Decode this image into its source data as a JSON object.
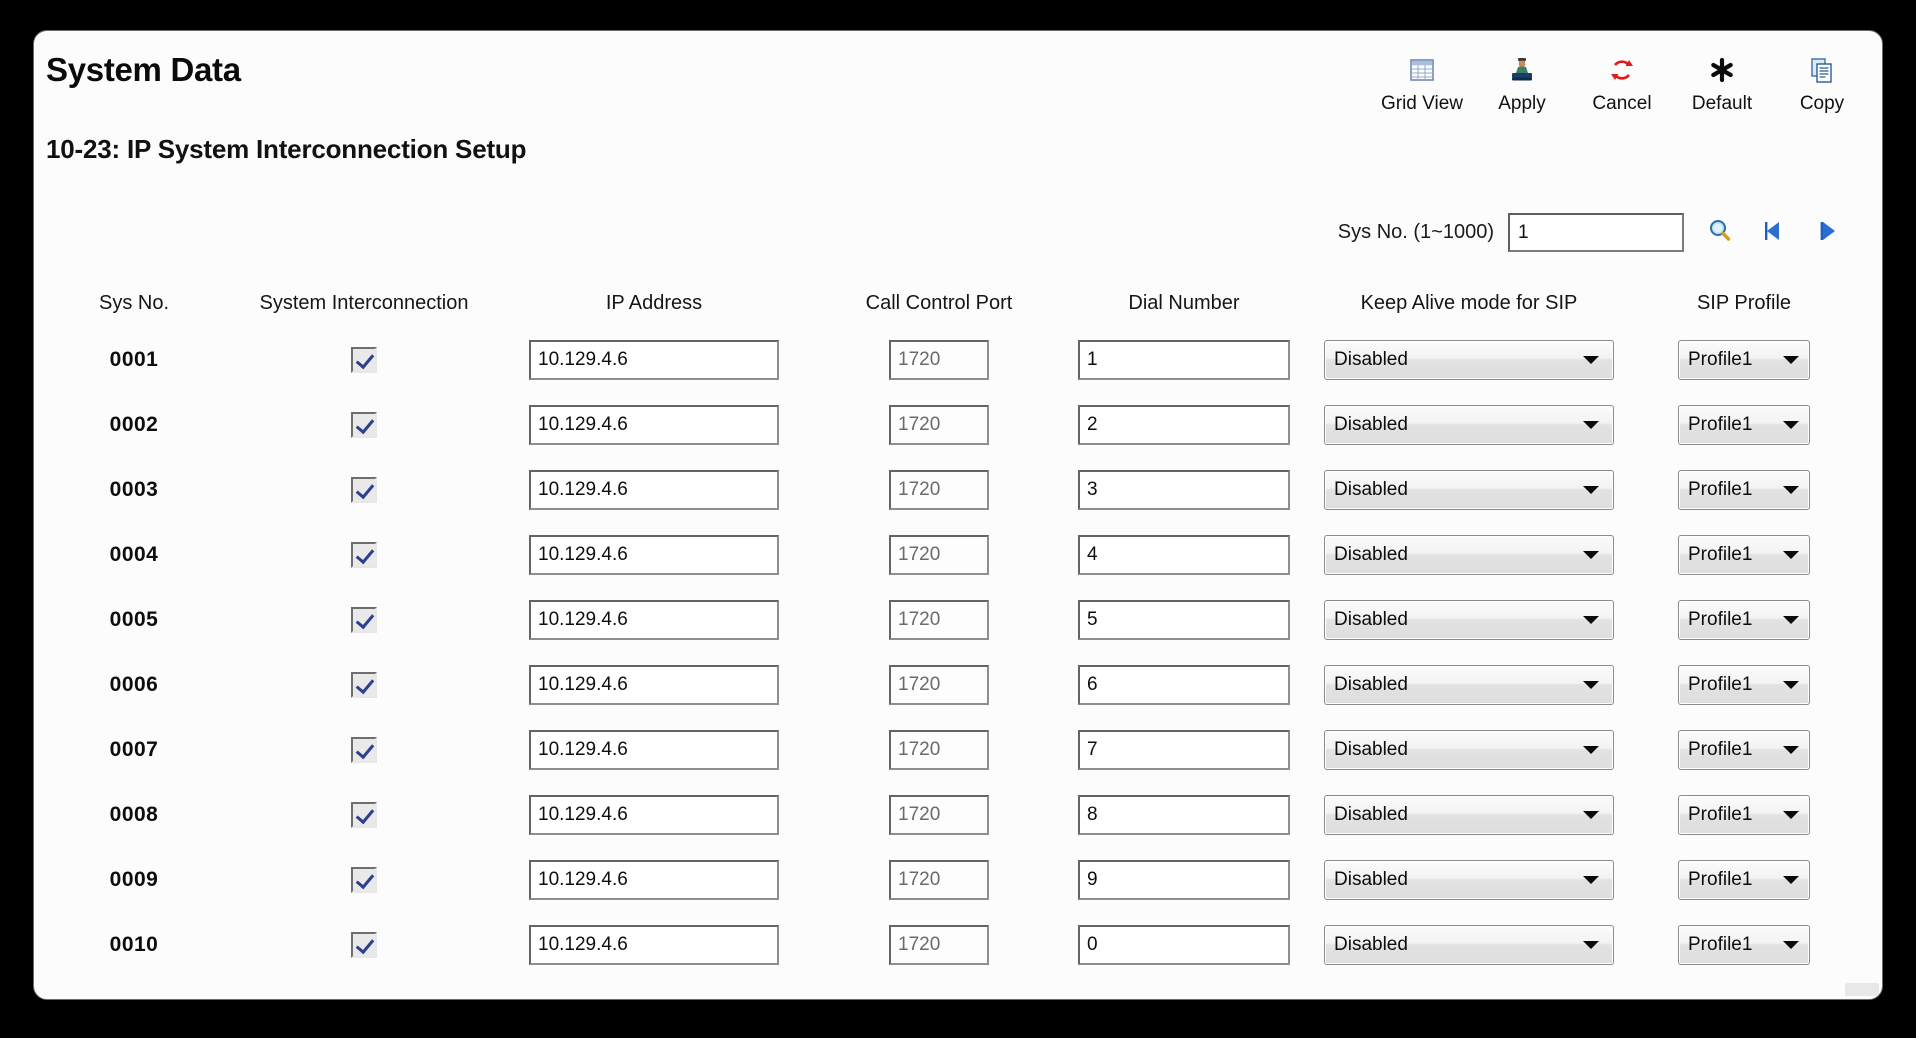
{
  "window": {
    "title": "System Data",
    "subtitle": "10-23: IP System Interconnection Setup"
  },
  "toolbar": {
    "buttons": [
      {
        "label": "Grid View",
        "icon": "grid-view-icon"
      },
      {
        "label": "Apply",
        "icon": "apply-stamp-icon"
      },
      {
        "label": "Cancel",
        "icon": "cancel-refresh-icon"
      },
      {
        "label": "Default",
        "icon": "default-asterisk-icon"
      },
      {
        "label": "Copy",
        "icon": "copy-pages-icon"
      }
    ]
  },
  "search": {
    "label": "Sys No. (1~1000)",
    "value": "1",
    "placeholder": "",
    "go_icon": "magnifier-icon",
    "prev_icon": "previous-arrow-icon",
    "next_icon": "next-arrow-icon"
  },
  "table": {
    "headers": [
      "Sys No.",
      "System Interconnection",
      "IP Address",
      "Call Control Port",
      "Dial Number",
      "Keep Alive mode for SIP",
      "SIP Profile"
    ],
    "rows": [
      {
        "sys_no": "0001",
        "interconnection": true,
        "ip_address": "10.129.4.6",
        "call_control_port": "1720",
        "dial_number": "1",
        "keep_alive": "Disabled",
        "sip_profile": "Profile1"
      },
      {
        "sys_no": "0002",
        "interconnection": true,
        "ip_address": "10.129.4.6",
        "call_control_port": "1720",
        "dial_number": "2",
        "keep_alive": "Disabled",
        "sip_profile": "Profile1"
      },
      {
        "sys_no": "0003",
        "interconnection": true,
        "ip_address": "10.129.4.6",
        "call_control_port": "1720",
        "dial_number": "3",
        "keep_alive": "Disabled",
        "sip_profile": "Profile1"
      },
      {
        "sys_no": "0004",
        "interconnection": true,
        "ip_address": "10.129.4.6",
        "call_control_port": "1720",
        "dial_number": "4",
        "keep_alive": "Disabled",
        "sip_profile": "Profile1"
      },
      {
        "sys_no": "0005",
        "interconnection": true,
        "ip_address": "10.129.4.6",
        "call_control_port": "1720",
        "dial_number": "5",
        "keep_alive": "Disabled",
        "sip_profile": "Profile1"
      },
      {
        "sys_no": "0006",
        "interconnection": true,
        "ip_address": "10.129.4.6",
        "call_control_port": "1720",
        "dial_number": "6",
        "keep_alive": "Disabled",
        "sip_profile": "Profile1"
      },
      {
        "sys_no": "0007",
        "interconnection": true,
        "ip_address": "10.129.4.6",
        "call_control_port": "1720",
        "dial_number": "7",
        "keep_alive": "Disabled",
        "sip_profile": "Profile1"
      },
      {
        "sys_no": "0008",
        "interconnection": true,
        "ip_address": "10.129.4.6",
        "call_control_port": "1720",
        "dial_number": "8",
        "keep_alive": "Disabled",
        "sip_profile": "Profile1"
      },
      {
        "sys_no": "0009",
        "interconnection": true,
        "ip_address": "10.129.4.6",
        "call_control_port": "1720",
        "dial_number": "9",
        "keep_alive": "Disabled",
        "sip_profile": "Profile1"
      },
      {
        "sys_no": "0010",
        "interconnection": true,
        "ip_address": "10.129.4.6",
        "call_control_port": "1720",
        "dial_number": "0",
        "keep_alive": "Disabled",
        "sip_profile": "Profile1"
      }
    ]
  },
  "colors": {
    "panel_background": "#fcfcfc",
    "outer_background": "#000000",
    "text": "#0d0d0d",
    "checkmark": "#2d3f8f",
    "nav_arrow": "#1f5fc0",
    "cancel_icon": "#d02020"
  }
}
